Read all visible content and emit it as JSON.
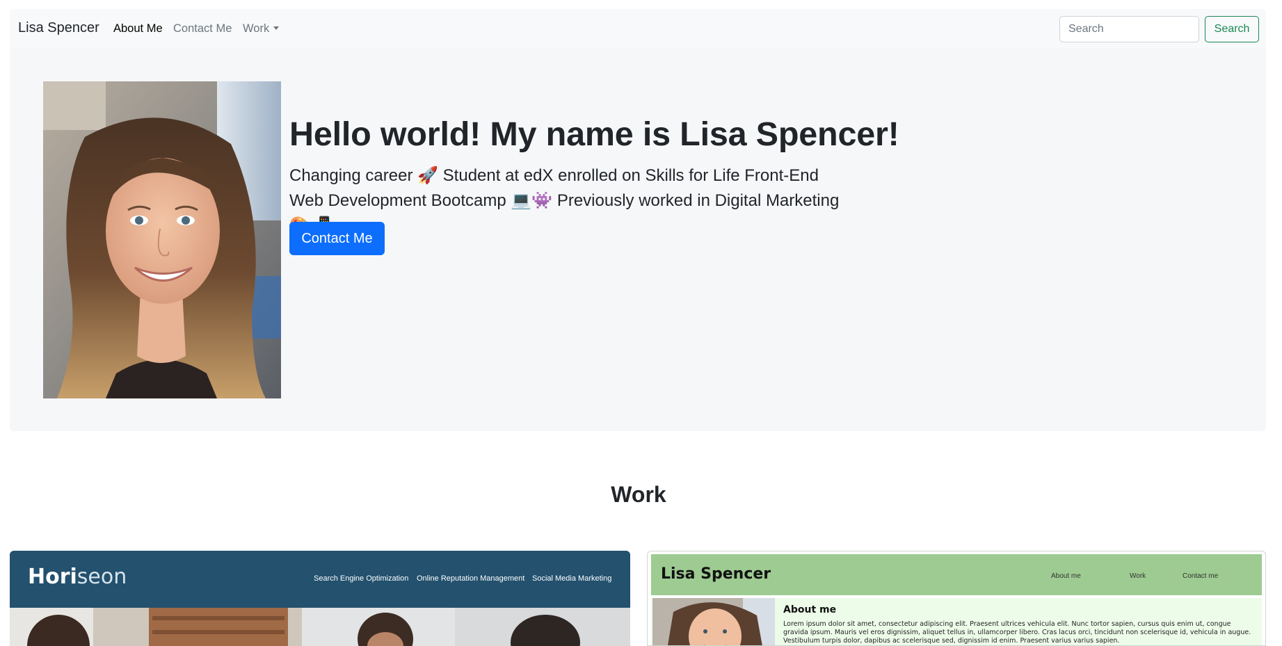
{
  "navbar": {
    "brand": "Lisa Spencer",
    "items": [
      {
        "label": "About Me",
        "active": true
      },
      {
        "label": "Contact Me",
        "active": false
      },
      {
        "label": "Work",
        "active": false,
        "dropdown": true
      }
    ],
    "search": {
      "placeholder": "Search",
      "value": "",
      "button_label": "Search"
    },
    "colors": {
      "success": "#198754",
      "background": "#f8f9fa"
    }
  },
  "hero": {
    "title": "Hello world! My name is Lisa Spencer!",
    "lead": "Changing career 🚀 Student at edX enrolled on Skills for Life Front-End Web Development Bootcamp 💻👾 Previously worked in Digital Marketing 🎨📲",
    "button_label": "Contact Me",
    "portrait_icon": "portrait-photo",
    "colors": {
      "primary": "#0d6efd",
      "background": "#f6f7f9"
    }
  },
  "work": {
    "heading": "Work",
    "projects": [
      {
        "name": "horiseon",
        "logo": {
          "bold": "Hori",
          "light": "seon"
        },
        "nav_links": [
          "Search Engine Optimization",
          "Online Reputation Management",
          "Social Media Marketing"
        ],
        "colors": {
          "header": "#23516e"
        }
      },
      {
        "name": "portfolio",
        "site_title": "Lisa Spencer",
        "nav_links": [
          "About me",
          "Work",
          "Contact me"
        ],
        "section_title": "About me",
        "paragraph": "Lorem ipsum dolor sit amet, consectetur adipiscing elit. Praesent ultrices vehicula elit. Nunc tortor sapien, cursus quis enim ut, congue gravida ipsum. Mauris vel eros dignissim, aliquet tellus in, ullamcorper libero. Cras lacus orci, tincidunt non scelerisque id, vehicula in augue. Vestibulum turpis dolor, dapibus ac scelerisque sed, dignissim id enim. Praesent varius varius sapien.",
        "colors": {
          "header": "#9dcb91",
          "body": "#edfce9"
        }
      }
    ]
  }
}
